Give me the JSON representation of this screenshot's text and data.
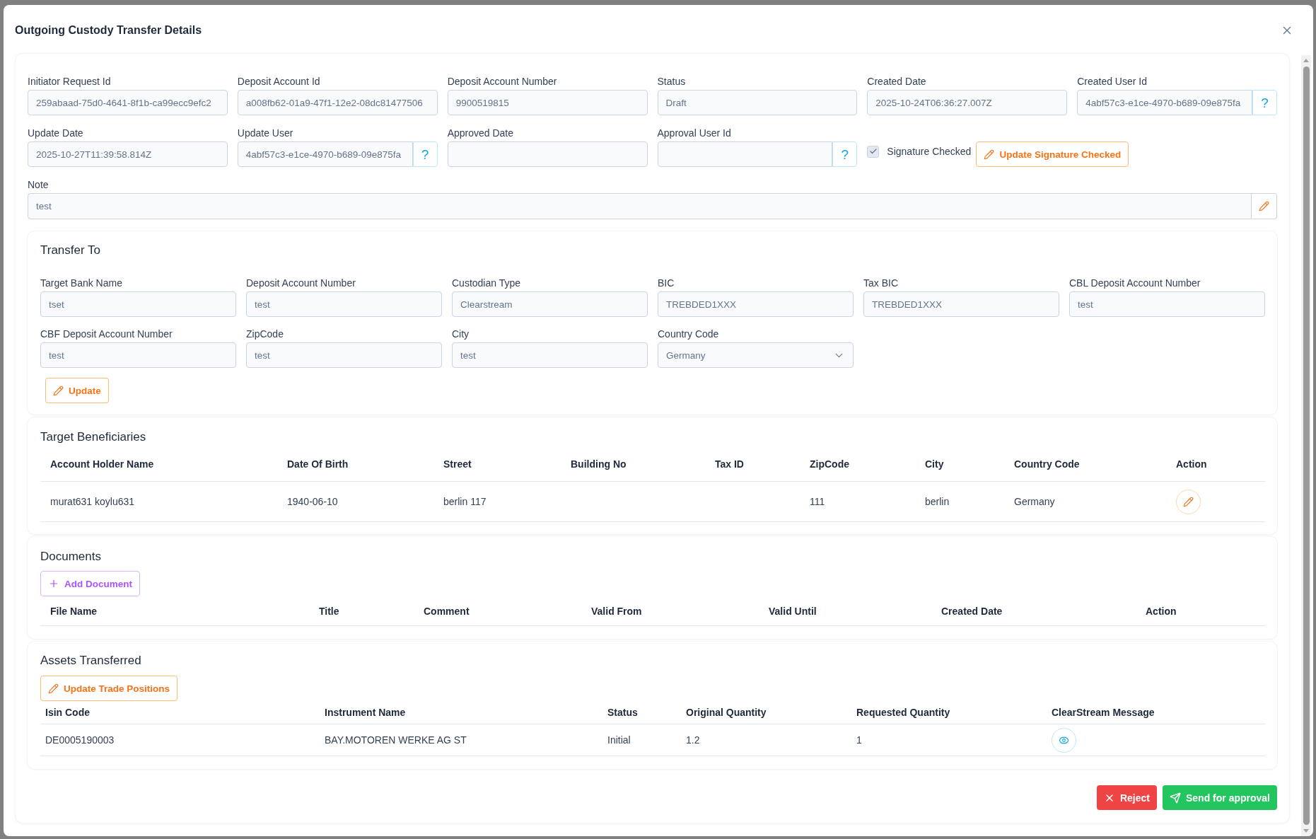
{
  "dialog": {
    "title": "Outgoing Custody Transfer Details"
  },
  "details": {
    "fields": [
      {
        "label": "Initiator Request Id",
        "value": "259abaad-75d0-4641-8f1b-ca99ecc9efc2"
      },
      {
        "label": "Deposit Account Id",
        "value": "a008fb62-01a9-47f1-12e2-08dc81477506"
      },
      {
        "label": "Deposit Account Number",
        "value": "9900519815"
      },
      {
        "label": "Status",
        "value": "Draft"
      },
      {
        "label": "Created Date",
        "value": "2025-10-24T06:36:27.007Z"
      },
      {
        "label": "Created User Id",
        "value": "4abf57c3-e1ce-4970-b689-09e875fa",
        "help_button": "?"
      },
      {
        "label": "Update Date",
        "value": "2025-10-27T11:39:58.814Z"
      },
      {
        "label": "Update User",
        "value": "4abf57c3-e1ce-4970-b689-09e875fa",
        "help_button": "?"
      },
      {
        "label": "Approved Date"
      },
      {
        "label": "Approval User Id",
        "help_button": "?"
      }
    ],
    "signature": {
      "label": "Signature Checked",
      "checked": true
    },
    "update_signature_button": "Update Signature Checked",
    "note": {
      "label": "Note",
      "value": "test"
    }
  },
  "transfer_to": {
    "title": "Transfer To",
    "fields": [
      {
        "label": "Target Bank Name",
        "value": "tset",
        "kind": "text"
      },
      {
        "label": "Deposit Account Number",
        "value": "test",
        "kind": "text"
      },
      {
        "label": "Custodian Type",
        "value": "Clearstream",
        "kind": "text"
      },
      {
        "label": "BIC",
        "value": "TREBDED1XXX",
        "kind": "text"
      },
      {
        "label": "Tax BIC",
        "value": "TREBDED1XXX",
        "kind": "text"
      },
      {
        "label": "CBL Deposit Account Number",
        "value": "test",
        "kind": "text"
      },
      {
        "label": "CBF Deposit Account Number",
        "value": "test",
        "kind": "text"
      },
      {
        "label": "ZipCode",
        "value": "test",
        "kind": "text"
      },
      {
        "label": "City",
        "value": "test",
        "kind": "text"
      },
      {
        "label": "Country Code",
        "value": "Germany",
        "kind": "select"
      }
    ],
    "update_button": "Update"
  },
  "target_beneficiaries": {
    "title": "Target Beneficiaries",
    "columns": [
      "Account Holder Name",
      "Date Of Birth",
      "Street",
      "Building No",
      "Tax ID",
      "ZipCode",
      "City",
      "Country Code",
      "Action"
    ],
    "rows": [
      {
        "account_holder_name": "murat631 koylu631",
        "date_of_birth": "1940-06-10",
        "street": "berlin 117",
        "zipcode": "111",
        "city": "berlin",
        "country_code": "Germany"
      }
    ]
  },
  "documents": {
    "title": "Documents",
    "add_button": "Add Document",
    "columns": [
      "File Name",
      "Title",
      "Comment",
      "Valid From",
      "Valid Until",
      "Created Date",
      "Action"
    ]
  },
  "assets_transferred": {
    "title": "Assets Transferred",
    "update_button": "Update Trade Positions",
    "columns": [
      "Isin Code",
      "Instrument Name",
      "Status",
      "Original Quantity",
      "Requested Quantity",
      "ClearStream Message"
    ],
    "rows": [
      {
        "isin_code": "DE0005190003",
        "instrument_name": "BAY.MOTOREN WERKE AG ST",
        "status": "Initial",
        "original_quantity": "1.2",
        "requested_quantity": "1"
      }
    ]
  },
  "footer": {
    "buttons": [
      {
        "label": "Reject",
        "kind": "danger"
      },
      {
        "label": "Send for approval",
        "kind": "primary"
      }
    ]
  }
}
